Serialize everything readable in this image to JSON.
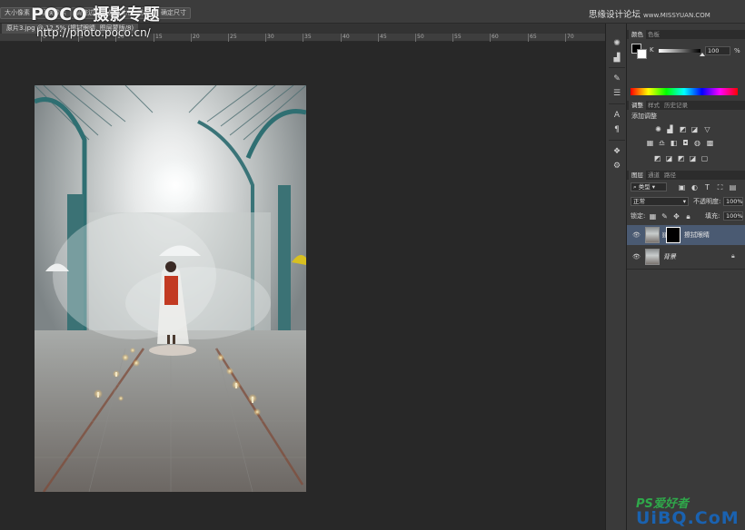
{
  "watermarks": {
    "poco_logo": "POCO",
    "poco_subtitle": "摄影专题",
    "poco_url": "http://photo.poco.cn/",
    "top_right_site_name": "思缘设计论坛",
    "top_right_url": "www.MISSYUAN.COM",
    "bottom_right_logo": "PS爱好者",
    "bottom_right_url": "UiBQ.CoM"
  },
  "options_bar": {
    "button1": "大小像素",
    "button2": "切换像素",
    "button3": "调整边缘",
    "button4": "像素比例",
    "button5": "前景色",
    "button6": "确定尺寸"
  },
  "document": {
    "tab_label": "原片3.jpg @ 12.5% (擦拭眼睛, 图层蒙版/8)",
    "ruler_labels": [
      "0",
      "5",
      "10",
      "15",
      "20",
      "25",
      "30",
      "35",
      "40",
      "45",
      "50",
      "55",
      "60",
      "65",
      "70"
    ]
  },
  "color_panel": {
    "tabs": [
      "颜色",
      "色板"
    ],
    "channel_label": "K",
    "channel_value": "100",
    "unit": "%"
  },
  "adjustments_panel": {
    "tabs": [
      "调整",
      "样式",
      "历史记录"
    ],
    "title": "添加调整"
  },
  "layers_panel": {
    "tabs": [
      "图层",
      "通道",
      "路径"
    ],
    "filter_label": "类型",
    "blend_mode": "正常",
    "opacity_label": "不透明度:",
    "opacity_value": "100%",
    "lock_label": "锁定:",
    "fill_label": "填充:",
    "fill_value": "100%",
    "layers": [
      {
        "name": "擦拭眼睛",
        "selected": true,
        "has_mask": true
      },
      {
        "name": "背景",
        "selected": false,
        "locked": true
      }
    ]
  },
  "icons": [
    "eye-icon",
    "lock-icon",
    "chain-link-icon",
    "brush-icon",
    "move-icon",
    "sun-icon",
    "levels-icon",
    "curves-icon",
    "triangle-icon"
  ],
  "colors": {
    "panel_bg": "#3a3a3a",
    "canvas_bg": "#282828",
    "selected_layer": "#4a5a72",
    "hue_spectrum": [
      "#ff0000",
      "#ffff00",
      "#00ff00",
      "#00ffff",
      "#0000ff",
      "#ff00ff",
      "#ff0000"
    ]
  }
}
